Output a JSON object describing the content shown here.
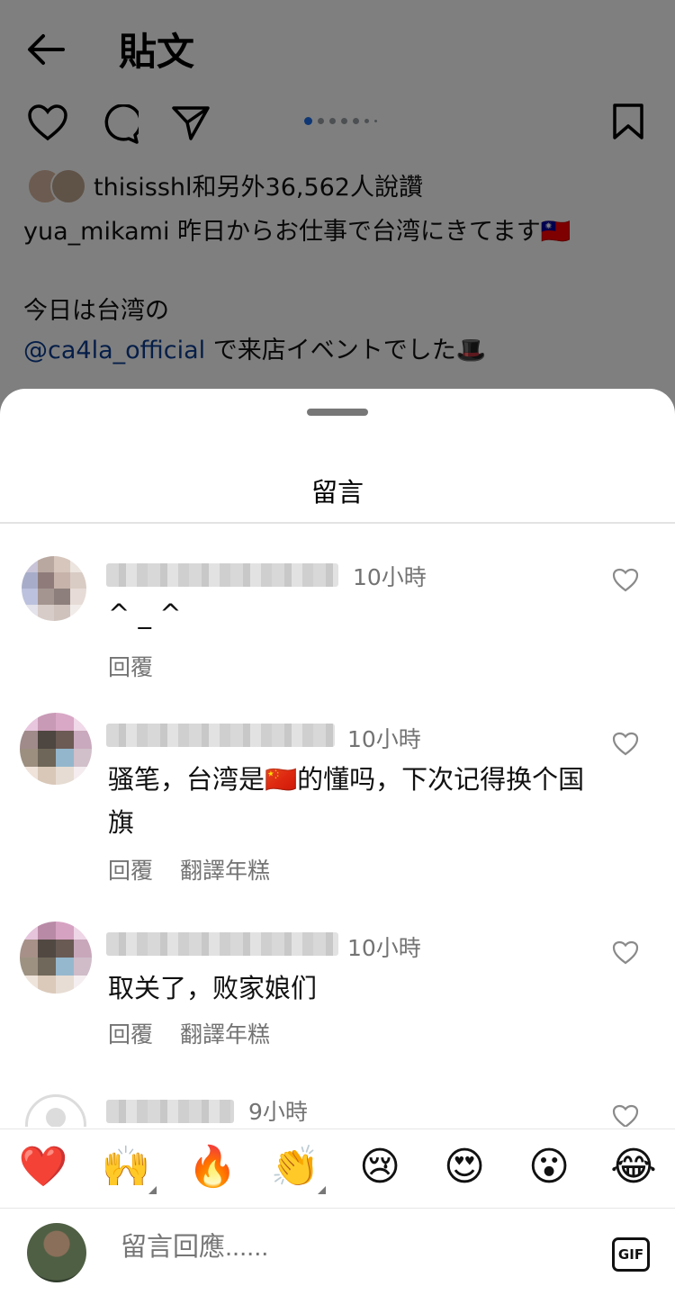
{
  "post_view": {
    "title": "貼文",
    "likes_text": "thisisshl和另外36,562人說讚",
    "caption_user": "yua_mikami",
    "caption_line1": "昨日からお仕事で台湾にきてます🇹🇼",
    "caption_line2": "今日は台湾の",
    "caption_mention": "@ca4la_official",
    "caption_line3": " で来店イベントでした🎩",
    "carousel_count": 7,
    "carousel_active_index": 0
  },
  "comments_sheet": {
    "title": "留言",
    "comments": [
      {
        "time": "10小時",
        "text": "^ _ ^",
        "reply_label": "回覆",
        "translate_label": ""
      },
      {
        "time": "10小時",
        "text": "骚笔，台湾是🇨🇳的懂吗，下次记得换个国旗",
        "reply_label": "回覆",
        "translate_label": "翻譯年糕"
      },
      {
        "time": "10小時",
        "text": "取关了，败家娘们",
        "reply_label": "回覆",
        "translate_label": "翻譯年糕"
      },
      {
        "time": "9小時",
        "text": "",
        "reply_label": "",
        "translate_label": ""
      }
    ]
  },
  "emoji_bar": [
    "❤️",
    "🙌",
    "🔥",
    "👏",
    "😢",
    "😍",
    "😮",
    "😂"
  ],
  "input": {
    "placeholder": "留言回應......",
    "gif_label": "GIF"
  },
  "icons": [
    "back-arrow-icon",
    "heart-icon",
    "comment-icon",
    "share-icon",
    "bookmark-icon",
    "gif-icon"
  ]
}
